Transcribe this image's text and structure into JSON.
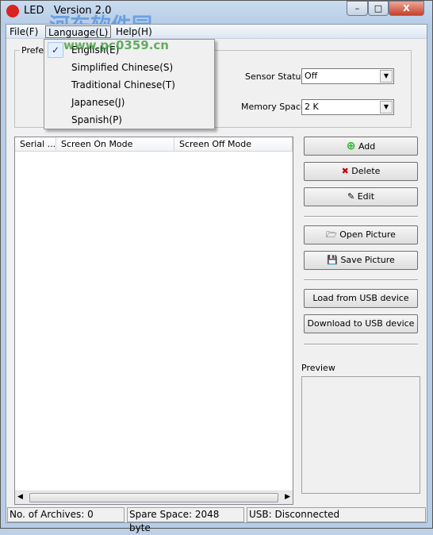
{
  "window": {
    "title": "LED   Version 2.0",
    "minimize": "–",
    "maximize": "□",
    "close": "X"
  },
  "watermark": {
    "text": "河东软件园",
    "url": "www.pc0359.cn"
  },
  "menubar": {
    "items": [
      "File(F)",
      "Language(L)",
      "Help(H)"
    ]
  },
  "language_menu": {
    "items": [
      "English(E)",
      "Simplified Chinese(S)",
      "Traditional Chinese(T)",
      "Japanese(J)",
      "Spanish(P)"
    ],
    "checked": "English(E)"
  },
  "preferences": {
    "legend": "Prefer",
    "sensor_label": "Sensor Status:",
    "sensor_value": "Off",
    "memory_label": "Memory Space:",
    "memory_value": "2 K"
  },
  "list": {
    "columns": [
      "Serial ...",
      "Screen On Mode",
      "Screen Off Mode"
    ],
    "rows": []
  },
  "buttons": {
    "add": "Add",
    "delete": "Delete",
    "edit": "Edit",
    "open": "Open Picture",
    "save": "Save Picture",
    "load": "Load from USB device",
    "download": "Download to USB device"
  },
  "preview_label": "Preview",
  "statusbar": {
    "archives": "No. of Archives: 0",
    "spare": "Spare Space: 2048 byte",
    "usb": "USB: Disconnected"
  },
  "colors": {
    "add": "#1fb81f",
    "delete": "#c00000"
  }
}
